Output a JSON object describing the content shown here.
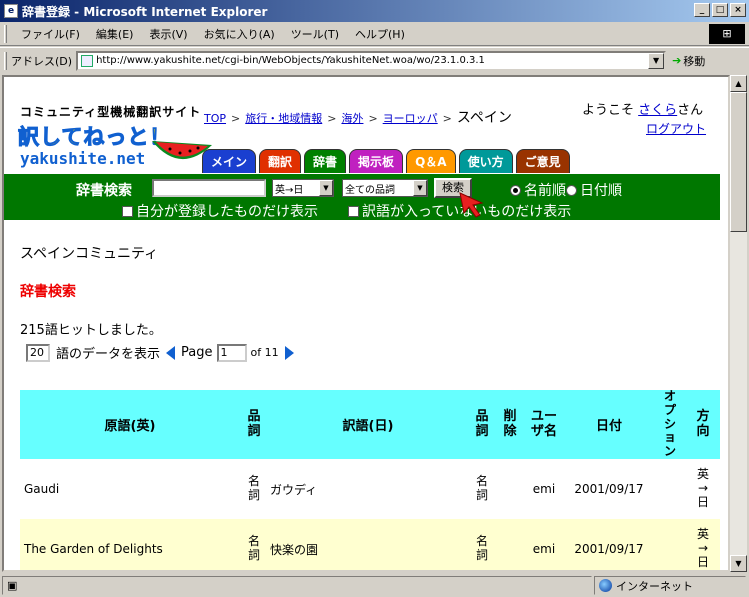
{
  "window": {
    "title": "辞書登録 - Microsoft Internet Explorer",
    "app_icon": "ie-page-icon"
  },
  "menu": [
    "ファイル(F)",
    "編集(E)",
    "表示(V)",
    "お気に入り(A)",
    "ツール(T)",
    "ヘルプ(H)"
  ],
  "address": {
    "label": "アドレス(D)",
    "url": "http://www.yakushite.net/cgi-bin/WebObjects/YakushiteNet.woa/wo/23.1.0.3.1",
    "go_label": "移動"
  },
  "site": {
    "tagline": "コミュニティ型機械翻訳サイト",
    "logo": "訳してねっと！",
    "domain": "yakushite.net"
  },
  "breadcrumb": {
    "items": [
      "TOP",
      "旅行・地域情報",
      "海外",
      "ヨーロッパ"
    ],
    "current": "スペイン"
  },
  "user": {
    "welcome_prefix": "ようこそ",
    "name": "さくら",
    "welcome_suffix": "さん",
    "logout": "ログアウト"
  },
  "tabs": [
    {
      "label": "メイン",
      "color": "#1a3fd0"
    },
    {
      "label": "翻訳",
      "color": "#e03000"
    },
    {
      "label": "辞書",
      "color": "#008000"
    },
    {
      "label": "掲示板",
      "color": "#c020c0"
    },
    {
      "label": "Q＆A",
      "color": "#ff9900"
    },
    {
      "label": "使い方",
      "color": "#009999"
    },
    {
      "label": "ご意見",
      "color": "#993300"
    }
  ],
  "search": {
    "label": "辞書検索",
    "query": "",
    "direction": "英→日",
    "pos": "全ての品詞",
    "button": "検索",
    "sort_name": "名前順",
    "sort_date": "日付順",
    "check_mine": "自分が登録したものだけ表示",
    "check_empty": "訳語が入っていないものだけ表示"
  },
  "community": "スペインコミュニティ",
  "section_title": "辞書検索",
  "hits": "215語ヒットしました。",
  "pager": {
    "per_page": "20",
    "per_page_label": "語のデータを表示",
    "page_label": "Page",
    "page": "1",
    "total": "of 11"
  },
  "table": {
    "headers": {
      "src": "原語(英)",
      "pos1": "品詞",
      "dst": "訳語(日)",
      "pos2": "品詞",
      "del": "削除",
      "user": "ユーザ名",
      "date": "日付",
      "option": "オプション",
      "dir": "方向"
    },
    "rows": [
      {
        "src": "Gaudi",
        "pos1": "名詞",
        "dst": "ガウディ",
        "pos2": "名詞",
        "user": "emi",
        "date": "2001/09/17",
        "dir": "英→日"
      },
      {
        "src": "The Garden of Delights",
        "pos1": "名詞",
        "dst": "快楽の園",
        "pos2": "名詞",
        "user": "emi",
        "date": "2001/09/17",
        "dir": "英→日"
      }
    ]
  },
  "status": {
    "zone": "インターネット"
  }
}
